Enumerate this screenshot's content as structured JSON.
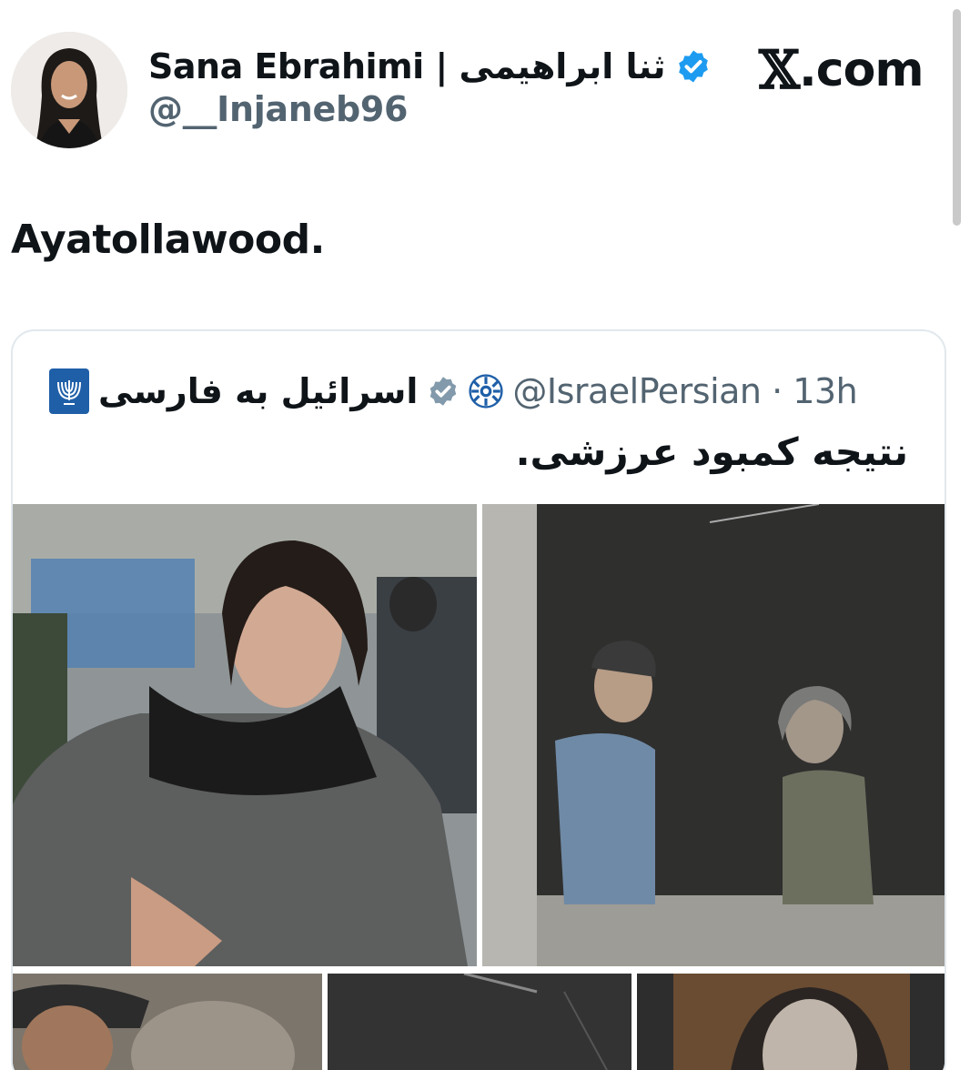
{
  "post": {
    "author": {
      "display_name": "Sana Ebrahimi | ثنا ابراهیمی",
      "handle": "@__Injaneb96",
      "verified_icon": "verified-badge-icon",
      "verified_color": "#1d9bf0"
    },
    "site_logo": {
      "x_mark": "𝕏",
      "domain": ".com"
    },
    "text": "Ayatollawood."
  },
  "quoted_post": {
    "author": {
      "display_name": "اسرائیل به فارسی",
      "handle_time": "@IsraelPersian · 13h",
      "avatar_icon": "menorah-emblem-icon",
      "verified_icon": "gray-verified-badge-icon",
      "affiliate_icon": "israel-government-badge-icon"
    },
    "text": "نتیجه کمبود عرزشی.",
    "photos": [
      {
        "name": "photo-woman-street"
      },
      {
        "name": "photo-couple-window"
      },
      {
        "name": "photo-bottom-left"
      },
      {
        "name": "photo-bottom-middle"
      },
      {
        "name": "photo-bottom-right"
      }
    ]
  },
  "colors": {
    "text_primary": "#0f1419",
    "text_secondary": "#536471",
    "border": "#e1e8ed"
  }
}
